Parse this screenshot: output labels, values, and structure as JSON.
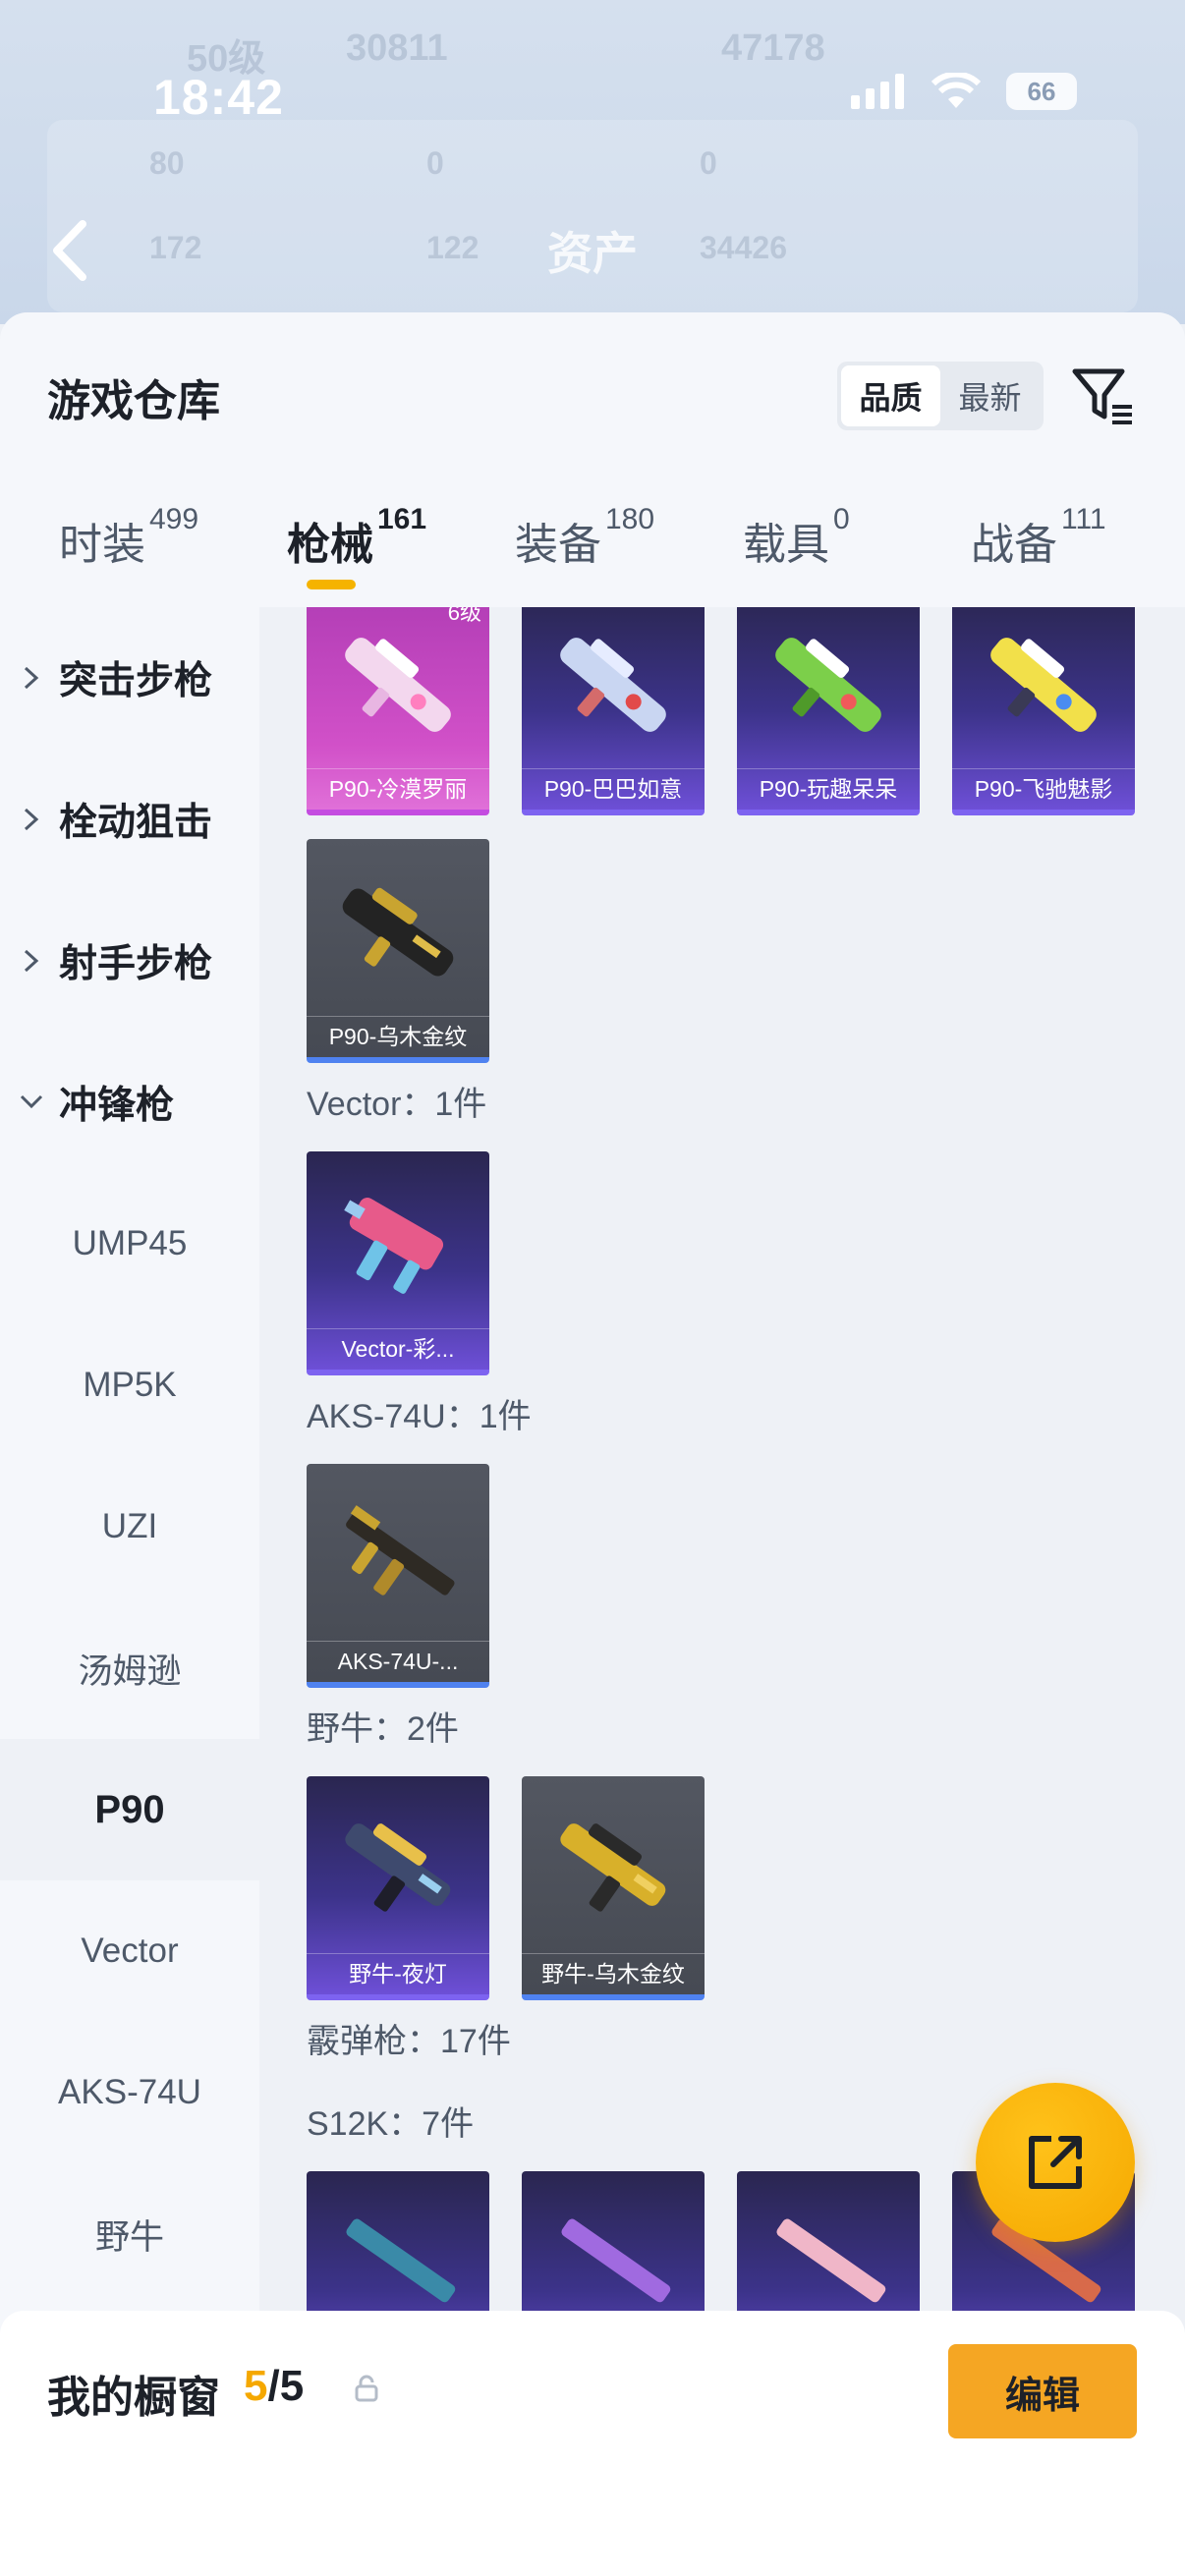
{
  "status_bar": {
    "time": "18:42",
    "battery": "66"
  },
  "background": {
    "level": "50级",
    "coins": "30811",
    "score": "47178",
    "stats": [
      "80",
      "0",
      "0",
      "172",
      "122",
      "34426"
    ]
  },
  "nav": {
    "title": "资产"
  },
  "sheet": {
    "title": "游戏仓库",
    "sort_options": [
      "品质",
      "最新"
    ],
    "sort_active": "品质"
  },
  "tabs": [
    {
      "label": "时装",
      "count": "499"
    },
    {
      "label": "枪械",
      "count": "161"
    },
    {
      "label": "装备",
      "count": "180"
    },
    {
      "label": "载具",
      "count": "0"
    },
    {
      "label": "战备",
      "count": "111"
    }
  ],
  "categories": {
    "main": [
      "突击步枪",
      "栓动狙击",
      "射手步枪",
      "冲锋枪"
    ],
    "sub": [
      "UMP45",
      "MP5K",
      "UZI",
      "汤姆逊",
      "P90",
      "Vector",
      "AKS-74U",
      "野牛"
    ],
    "selected": "P90"
  },
  "skins": {
    "p90_row1": [
      {
        "name": "P90-冷漠罗丽",
        "level": "6级",
        "rarity": "pink"
      },
      {
        "name": "P90-巴巴如意",
        "rarity": "purple"
      },
      {
        "name": "P90-玩趣呆呆",
        "rarity": "purple"
      },
      {
        "name": "P90-飞驰魅影",
        "rarity": "purple"
      }
    ],
    "p90_row2": [
      {
        "name": "P90-乌木金纹",
        "rarity": "gray"
      }
    ],
    "vector_title": "Vector：1件",
    "vector": [
      {
        "name": "Vector-彩...",
        "rarity": "purple"
      }
    ],
    "aks_title": "AKS-74U：1件",
    "aks": [
      {
        "name": "AKS-74U-...",
        "rarity": "gray"
      }
    ],
    "bison_title": "野牛：2件",
    "bison": [
      {
        "name": "野牛-夜灯",
        "rarity": "purple"
      },
      {
        "name": "野牛-乌木金纹",
        "rarity": "gray"
      }
    ],
    "shotgun_title": "霰弹枪：17件",
    "s12k_title": "S12K：7件"
  },
  "showcase": {
    "title": "我的橱窗",
    "current": "5",
    "total": "/5",
    "edit_label": "编辑"
  },
  "colors": {
    "accent": "#f5a800",
    "rare_purple": "#7d63f0",
    "rare_pink": "#c44ce0",
    "rare_blue": "#4f82f0"
  }
}
